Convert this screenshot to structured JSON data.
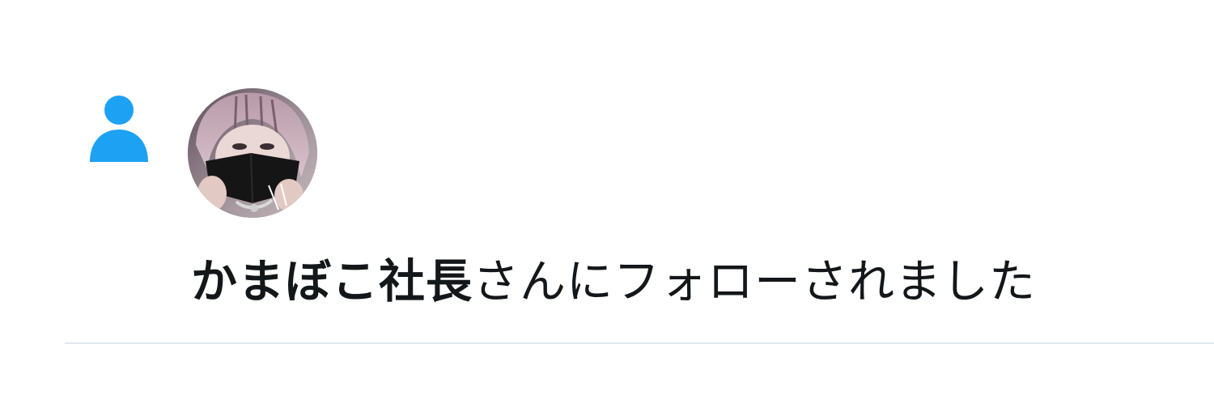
{
  "notification": {
    "type_icon": "person-icon",
    "accent_color": "#1da1f2",
    "user_display_name": "かまぼこ社長",
    "action_text": "さんにフォローされました",
    "avatar_icon": "user-avatar"
  },
  "colors": {
    "text": "#14171a",
    "divider": "#e1e8ed",
    "background": "#ffffff"
  }
}
